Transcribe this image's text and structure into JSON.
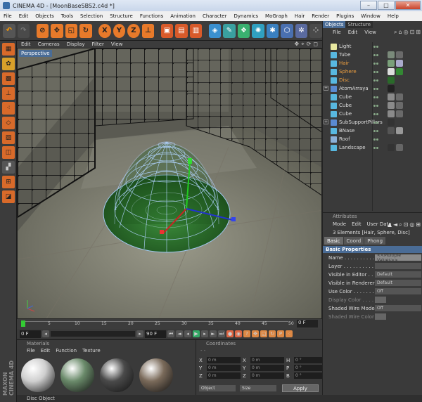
{
  "window": {
    "title": "CINEMA 4D - [MoonBaseSBS2.c4d *]",
    "min": "–",
    "max": "□",
    "close": "✕"
  },
  "menu": [
    "File",
    "Edit",
    "Objects",
    "Tools",
    "Selection",
    "Structure",
    "Functions",
    "Animation",
    "Character",
    "Dynamics",
    "MoGraph",
    "Hair",
    "Render",
    "Plugins",
    "Window",
    "Help"
  ],
  "toolbar": {
    "axis_x": "X",
    "axis_y": "Y",
    "axis_z": "Z"
  },
  "viewport": {
    "menu": [
      "Edit",
      "Cameras",
      "Display",
      "Filter",
      "View"
    ],
    "label": "Perspective",
    "nav_icons": [
      "move-icon",
      "zoom-icon",
      "rotate-icon",
      "maximize-icon"
    ]
  },
  "timeline": {
    "ticks": [
      "0",
      "5",
      "10",
      "15",
      "20",
      "25",
      "30",
      "35",
      "40",
      "45",
      "50"
    ],
    "frame_field": "0 F"
  },
  "playbar": {
    "start": "0 F",
    "end": "90 F"
  },
  "materials": {
    "title": "Materials",
    "menu": [
      "File",
      "Edit",
      "Function",
      "Texture"
    ],
    "colors": [
      "#cfcfcf",
      "#6a8a6a",
      "#4a4a4a",
      "#7a6a5a"
    ]
  },
  "coordinates": {
    "title": "Coordinates",
    "rows": [
      {
        "a": "X",
        "av": "0 m",
        "b": "X",
        "bv": "0 m",
        "c": "H",
        "cv": "0 °"
      },
      {
        "a": "Y",
        "av": "0 m",
        "b": "Y",
        "bv": "0 m",
        "c": "P",
        "cv": "0 °"
      },
      {
        "a": "Z",
        "av": "0 m",
        "b": "Z",
        "bv": "0 m",
        "c": "B",
        "cv": "0 °"
      }
    ],
    "mode": "Object",
    "size_mode": "Size",
    "apply": "Apply"
  },
  "status": "Disc Object",
  "object_manager": {
    "tabs": [
      "Objects",
      "Structure"
    ],
    "menu": [
      "File",
      "Edit",
      "View"
    ],
    "objects": [
      {
        "name": "Light",
        "color": "#e8e8a0",
        "tags": [],
        "selected": false,
        "expander": ""
      },
      {
        "name": "Tube",
        "color": "#58b8e0",
        "tags": [
          "#7a8a7a",
          "#6a6a6a"
        ],
        "selected": false,
        "expander": ""
      },
      {
        "name": "Hair",
        "color": "#58b8e0",
        "tags": [
          "#7aa07a",
          "#aac"
        ],
        "selected": true,
        "expander": ""
      },
      {
        "name": "Sphere",
        "color": "#58b8e0",
        "tags": [
          "#ddd",
          "#383"
        ],
        "selected": true,
        "expander": ""
      },
      {
        "name": "Disc",
        "color": "#58b8e0",
        "tags": [
          "#2a6a2a"
        ],
        "selected": true,
        "expander": ""
      },
      {
        "name": "AtomArraya",
        "color": "#5a8ad0",
        "tags": [
          "#222"
        ],
        "selected": false,
        "expander": "+"
      },
      {
        "name": "Cube",
        "color": "#58b8e0",
        "tags": [
          "#8a8a8a",
          "#6a6a6a"
        ],
        "selected": false,
        "expander": ""
      },
      {
        "name": "Cube",
        "color": "#58b8e0",
        "tags": [
          "#8a8a8a",
          "#6a6a6a"
        ],
        "selected": false,
        "expander": ""
      },
      {
        "name": "Cube",
        "color": "#58b8e0",
        "tags": [
          "#8a8a8a",
          "#6a6a6a"
        ],
        "selected": false,
        "expander": ""
      },
      {
        "name": "SubSupportPillars",
        "color": "#5a8ad0",
        "tags": [
          "#333"
        ],
        "selected": false,
        "expander": "+"
      },
      {
        "name": "BNase",
        "color": "#58b8e0",
        "tags": [
          "#555",
          "#999"
        ],
        "selected": false,
        "expander": ""
      },
      {
        "name": "Roof",
        "color": "#8ab0d8",
        "tags": [],
        "selected": false,
        "expander": ""
      },
      {
        "name": "Landscape",
        "color": "#58b8e0",
        "tags": [
          "#333",
          "#666"
        ],
        "selected": false,
        "expander": ""
      }
    ]
  },
  "attributes": {
    "title": "Attributes",
    "menu": [
      "Mode",
      "Edit",
      "User Data"
    ],
    "elements": "3 Elements [Hair, Sphere, Disc]",
    "tabs": [
      "Basic",
      "Coord",
      "Phong"
    ],
    "section": "Basic Properties",
    "rows": [
      {
        "label": "Name . . . . . . . . . . .",
        "value": "<<Multiple Values>>",
        "kind": "light",
        "dim": false
      },
      {
        "label": "Layer . . . . . . . . . .",
        "value": "",
        "kind": "normal",
        "dim": false
      },
      {
        "label": "Visible in Editor . . . .",
        "value": "Default",
        "kind": "normal",
        "dim": false
      },
      {
        "label": "Visible in Renderer . .",
        "value": "Default",
        "kind": "normal",
        "dim": false
      },
      {
        "label": "Use Color . . . . . . . .",
        "value": "Off",
        "kind": "normal",
        "dim": false
      },
      {
        "label": "Display Color . . . . .",
        "value": "",
        "kind": "color",
        "dim": true
      },
      {
        "label": "Shaded Wire Mode",
        "value": "Off",
        "kind": "normal",
        "dim": false
      },
      {
        "label": "Shaded Wire Color",
        "value": "",
        "kind": "color",
        "dim": true
      }
    ]
  }
}
